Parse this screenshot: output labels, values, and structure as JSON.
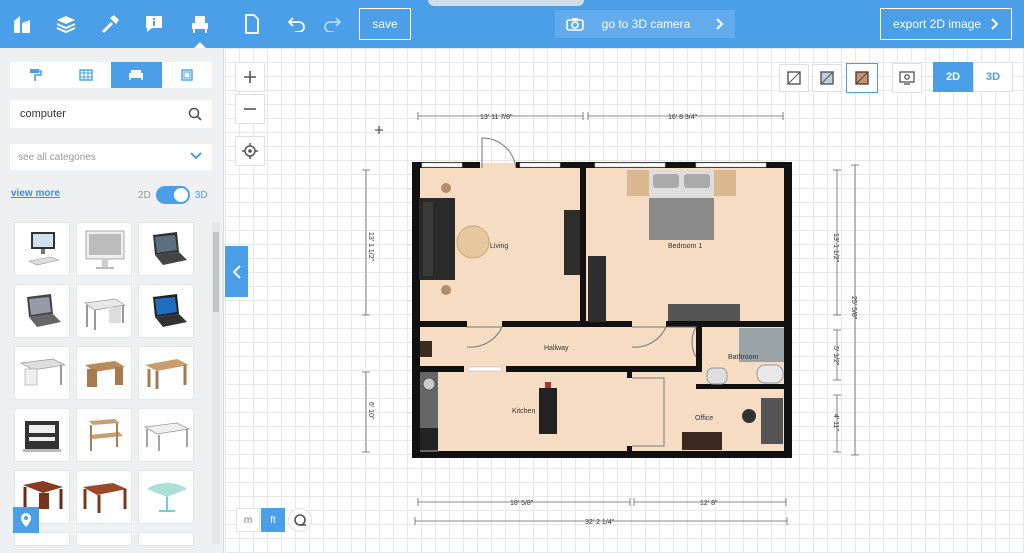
{
  "toolbar": {
    "save_label": "save",
    "camera_label": "go to 3D camera",
    "export_label": "export 2D image"
  },
  "sidebar": {
    "search_value": "computer",
    "category_select": "see all categories",
    "view_more": "view more",
    "toggle_2d": "2D",
    "toggle_3d": "3D"
  },
  "view": {
    "mode_2d": "2D",
    "mode_3d": "3D",
    "unit_m": "m",
    "unit_ft": "ft"
  },
  "plan": {
    "rooms": {
      "living": "Living",
      "bedroom": "Bedroom 1",
      "hallway": "Hallway",
      "bathroom": "Bathroom",
      "kitchen": "Kitchen",
      "office": "Office"
    },
    "dims": {
      "top_left": "13' 11 7/8\"",
      "top_right": "16' 8 3/4\"",
      "left_upper": "13' 1 1/2\"",
      "left_lower": "6' 10\"",
      "right_upper": "13' 1 1/2\"",
      "right_total": "25' 5/8\"",
      "right_mid": "5' 1/2\"",
      "right_lower": "4' 11\"",
      "bottom_left": "18' 5/8\"",
      "bottom_right": "12' 8\"",
      "bottom_total": "32' 2 1/4\""
    }
  },
  "colors": {
    "accent": "#4a9fe8",
    "floor": "#f7dcc4",
    "wall": "#111111"
  }
}
